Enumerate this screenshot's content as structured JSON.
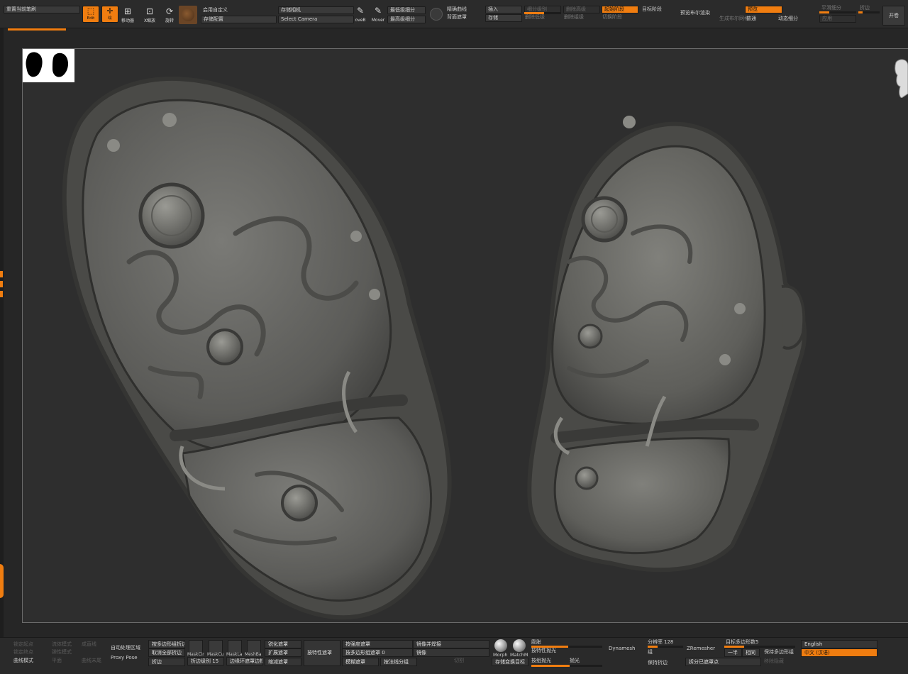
{
  "colors": {
    "accent": "#f07d10",
    "panel": "#2b2b2b",
    "canvas": "#2e2e2e",
    "model": "#6e6e6a"
  },
  "top": {
    "brush_field": "重置当前笔刷",
    "edit": {
      "label": "Edit",
      "icon": "edit-icon"
    },
    "draw": {
      "label": "绘",
      "icon": "draw-icon"
    },
    "move_sub": "移动器",
    "scale_sub": "X缩放",
    "rotate_sub": "旋转",
    "custom_enable": "启用自定义",
    "save_config": "存储配置",
    "save_camera": "存储相机",
    "select_camera": "Select Camera",
    "move_brush": "oveB",
    "mover_brush": "Mover",
    "lowest_subdiv": "最低级细分",
    "highest_subdiv": "最高级细分",
    "precise_curve": "精确曲线",
    "back_mask": "背面遮罩",
    "insert": "插入",
    "store": "存储",
    "subdiv_dim": "细分级别",
    "del_lower": "删除低级",
    "del_higher": "删除高级",
    "del_dim": "删除组级",
    "start_stage": "起始阶段",
    "target_stage": "目标阶段",
    "switch_stage": "切换阶段",
    "preview_bool": "预览布尔渲染",
    "preview": "预览",
    "gen_poly": "生成布尔网格",
    "normal": "普通",
    "dynamic_subdiv": "动态细分",
    "smooth_subdiv": "平滑细分",
    "apply": "应用",
    "crease": "折边",
    "open": "开卷"
  },
  "bottom": {
    "brush_modes": [
      "锁定起点",
      "锁定终点",
      "曲线模式"
    ],
    "fluid_modes": [
      "流体模式",
      "弹性模式",
      "平面"
    ],
    "snap_modes": [
      "成直线",
      "",
      "曲线末尾"
    ],
    "auto_region": "自动处理区域",
    "proxy_pose": "Proxy Pose",
    "poly_crease": "按多边形组折边",
    "cancel_crease": "取消全部折边",
    "crease": "折边",
    "crease_level": "折边级别",
    "crease_level_value": "15",
    "masks": [
      "MaskCir",
      "MaskCu",
      "MaskLa",
      "MeshBa"
    ],
    "edge_loop_mask": "边缘环遮罩边框",
    "sharpen_mask": "锐化遮罩",
    "grow_mask": "扩展遮罩",
    "shrink_mask": "缩减遮罩",
    "feature_mask": "按特性遮罩",
    "by_strength_mask": "按强度遮罩",
    "by_polygroup_mask": "按多边形组遮罩",
    "by_polygroup_value": "0",
    "blur_mask": "模糊遮罩",
    "by_normal_group": "按法线分组",
    "mirror_weld": "镜像并焊接",
    "mirror": "镜像",
    "cut_dim": "切割",
    "morph": "Morph",
    "matchmaker": "MatchM",
    "save_morph": "存储变换目标",
    "inflate": "膨胀",
    "by_feature_polish": "按特性抛光",
    "by_group_polish": "按组抛光",
    "polish": "抛光",
    "dynamesh": "Dynamesh",
    "resolution_label": "分辨率",
    "resolution_value": "128",
    "group": "组",
    "keep_crease": "保持折边",
    "zremesher": "ZRemesher",
    "target_poly_label": "目标多边形数",
    "target_poly_value": "5",
    "half": "一半",
    "same": "相同",
    "keep_poly_groups": "保持多边形组",
    "split_masked": "拆分已遮罩点",
    "split_dim": "移除隐藏",
    "english": "English",
    "chinese": "中文 (汉语)"
  }
}
